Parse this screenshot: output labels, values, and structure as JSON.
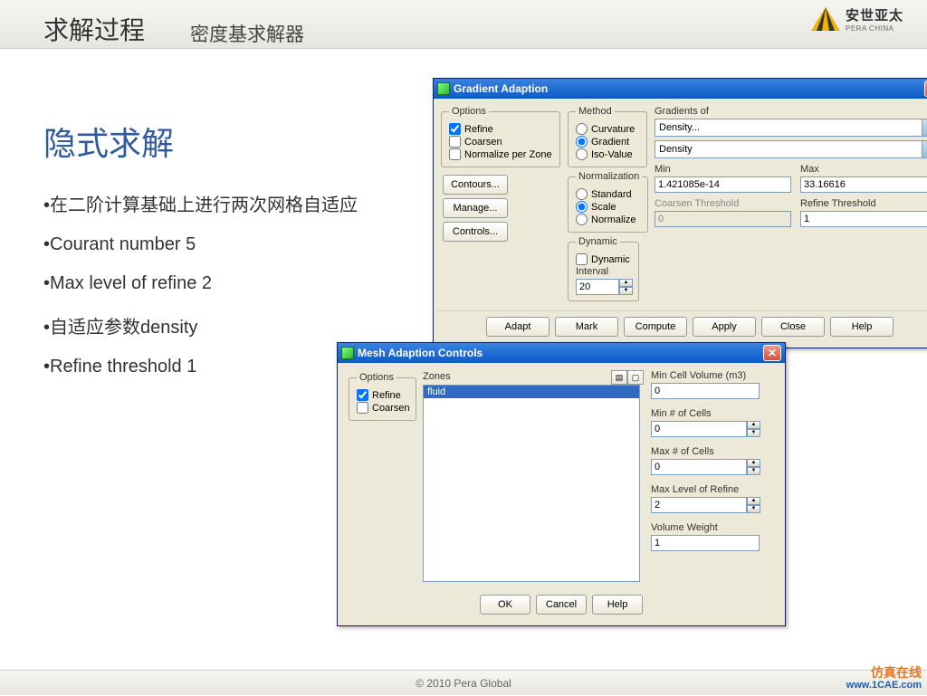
{
  "top": {
    "title1": "求解过程",
    "title2": "密度基求解器",
    "logo_text": "安世亚太",
    "logo_sub": "PERA CHINA"
  },
  "slide": {
    "heading": "隐式求解",
    "bullets": [
      "在二阶计算基础上进行两次网格自适应",
      "Courant number 5",
      "Max level of refine 2",
      "自适应参数density",
      "Refine threshold 1"
    ]
  },
  "footer": "© 2010 Pera Global",
  "watermark": {
    "line1": "仿真在线",
    "line2": "www.1CAE.com"
  },
  "gradient": {
    "title": "Gradient Adaption",
    "options": {
      "legend": "Options",
      "refine": "Refine",
      "coarsen": "Coarsen",
      "normalize": "Normalize per Zone"
    },
    "contours_btn": "Contours...",
    "manage_btn": "Manage...",
    "controls_btn": "Controls...",
    "method": {
      "legend": "Method",
      "curvature": "Curvature",
      "gradient": "Gradient",
      "isovalue": "Iso-Value"
    },
    "normalization": {
      "legend": "Normalization",
      "standard": "Standard",
      "scale": "Scale",
      "normalize": "Normalize"
    },
    "dynamic": {
      "legend": "Dynamic",
      "dynamic": "Dynamic",
      "interval_label": "Interval",
      "interval": "20"
    },
    "gradients_of_label": "Gradients of",
    "gradients_of_1": "Density...",
    "gradients_of_2": "Density",
    "min_label": "Min",
    "min": "1.421085e-14",
    "max_label": "Max",
    "max": "33.16616",
    "coarsen_th_label": "Coarsen Threshold",
    "coarsen_th": "0",
    "refine_th_label": "Refine Threshold",
    "refine_th": "1",
    "buttons": {
      "adapt": "Adapt",
      "mark": "Mark",
      "compute": "Compute",
      "apply": "Apply",
      "close": "Close",
      "help": "Help"
    }
  },
  "mesh": {
    "title": "Mesh Adaption Controls",
    "options": {
      "legend": "Options",
      "refine": "Refine",
      "coarsen": "Coarsen"
    },
    "zones_label": "Zones",
    "zones_item": "fluid",
    "min_cell_vol_label": "Min Cell Volume (m3)",
    "min_cell_vol": "0",
    "min_cells_label": "Min # of Cells",
    "min_cells": "0",
    "max_cells_label": "Max # of Cells",
    "max_cells": "0",
    "max_refine_label": "Max Level of Refine",
    "max_refine": "2",
    "vol_weight_label": "Volume Weight",
    "vol_weight": "1",
    "buttons": {
      "ok": "OK",
      "cancel": "Cancel",
      "help": "Help"
    }
  }
}
